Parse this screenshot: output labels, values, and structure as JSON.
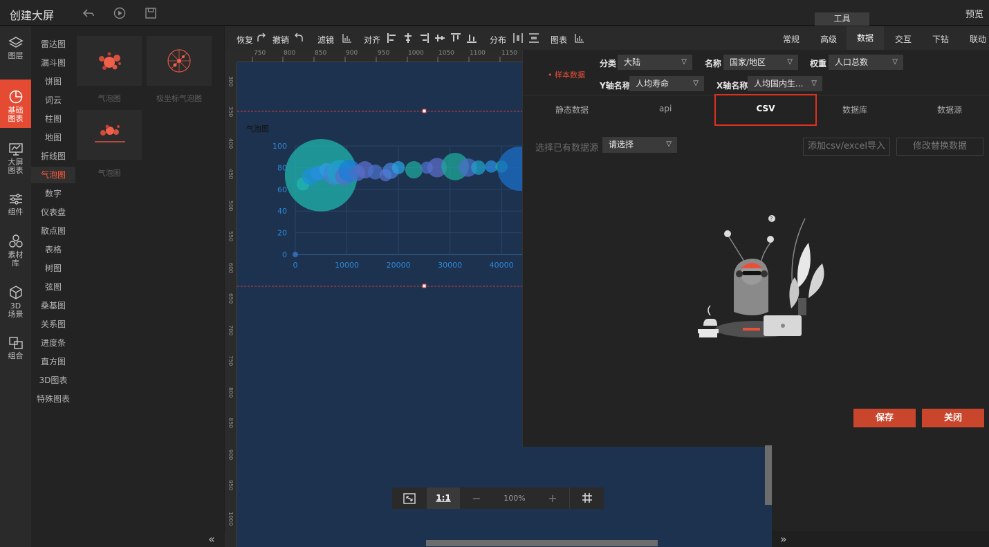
{
  "app": {
    "title": "创建大屏",
    "preview": "预览",
    "tools_tab": "工具"
  },
  "rail": [
    {
      "label": "图层",
      "icon": "layers-icon"
    },
    {
      "label": "基础图表",
      "icon": "pie-chart-icon",
      "active": true
    },
    {
      "label": "大屏图表",
      "icon": "dashboard-chart-icon"
    },
    {
      "label": "组件",
      "icon": "sliders-icon"
    },
    {
      "label": "素材库",
      "icon": "material-icon"
    },
    {
      "label": "3D场景",
      "icon": "cube-icon"
    },
    {
      "label": "组合",
      "icon": "combine-icon"
    }
  ],
  "categories": [
    "雷达图",
    "漏斗图",
    "饼图",
    "词云",
    "柱图",
    "地图",
    "折线图",
    "气泡图",
    "数字",
    "仪表盘",
    "散点图",
    "表格",
    "树图",
    "弦图",
    "桑基图",
    "关系图",
    "进度条",
    "直方图",
    "3D图表",
    "特殊图表"
  ],
  "active_category": "气泡图",
  "thumbs": [
    {
      "label": "气泡图"
    },
    {
      "label": "极坐标气泡图"
    },
    {
      "label": "气泡图"
    }
  ],
  "toolbar": {
    "redo": "恢复",
    "undo": "撤销",
    "filter": "滤镜",
    "align": "对齐",
    "distribute": "分布",
    "chart": "图表"
  },
  "ruler_h": [
    "750",
    "800",
    "850",
    "900",
    "950",
    "1000",
    "1050",
    "1100",
    "1150"
  ],
  "ruler_v": [
    "300",
    "350",
    "400",
    "450",
    "500",
    "550",
    "600",
    "650",
    "700",
    "750",
    "800",
    "850",
    "900",
    "950",
    "1000"
  ],
  "chart": {
    "title": "气泡图",
    "yticks": [
      "0",
      "20",
      "40",
      "60",
      "80",
      "100"
    ],
    "xticks": [
      "0",
      "10000",
      "20000",
      "30000",
      "40000"
    ]
  },
  "chart_data": {
    "type": "scatter",
    "title": "气泡图",
    "xlim": [
      0,
      44000
    ],
    "ylim": [
      0,
      100
    ],
    "x_ticks": [
      0,
      10000,
      20000,
      30000,
      40000
    ],
    "y_ticks": [
      0,
      20,
      40,
      60,
      80,
      100
    ],
    "points": [
      {
        "x": 5000,
        "y": 73,
        "r": 1400,
        "color": "#1fb5b0"
      },
      {
        "x": 1500,
        "y": 65,
        "r": 45,
        "color": "#1fb5b0"
      },
      {
        "x": 3000,
        "y": 72,
        "r": 80,
        "color": "#1d8fd8"
      },
      {
        "x": 4500,
        "y": 75,
        "r": 60,
        "color": "#2a8de0"
      },
      {
        "x": 6000,
        "y": 78,
        "r": 50,
        "color": "#2ba0e0"
      },
      {
        "x": 7500,
        "y": 74,
        "r": 120,
        "color": "#4a7fd8"
      },
      {
        "x": 8500,
        "y": 76,
        "r": 160,
        "color": "#1fa0c8"
      },
      {
        "x": 9500,
        "y": 72,
        "r": 90,
        "color": "#5470c6"
      },
      {
        "x": 10500,
        "y": 77,
        "r": 130,
        "color": "#1b7fd8"
      },
      {
        "x": 12000,
        "y": 75,
        "r": 70,
        "color": "#4a6fc8"
      },
      {
        "x": 13500,
        "y": 78,
        "r": 80,
        "color": "#5a6dc8"
      },
      {
        "x": 15500,
        "y": 76,
        "r": 60,
        "color": "#4a6fc8"
      },
      {
        "x": 17500,
        "y": 73,
        "r": 40,
        "color": "#5470c6"
      },
      {
        "x": 18500,
        "y": 77,
        "r": 70,
        "color": "#4a7fd8"
      },
      {
        "x": 20000,
        "y": 80,
        "r": 45,
        "color": "#2ba0e0"
      },
      {
        "x": 23000,
        "y": 78,
        "r": 80,
        "color": "#1fa89b"
      },
      {
        "x": 25500,
        "y": 80,
        "r": 40,
        "color": "#4a6fc8"
      },
      {
        "x": 27500,
        "y": 80,
        "r": 100,
        "color": "#5a6dc8"
      },
      {
        "x": 31000,
        "y": 81,
        "r": 200,
        "color": "#1fa89b"
      },
      {
        "x": 33500,
        "y": 80,
        "r": 90,
        "color": "#4a6fc8"
      },
      {
        "x": 35500,
        "y": 80,
        "r": 55,
        "color": "#1fa0c8"
      },
      {
        "x": 38000,
        "y": 81,
        "r": 40,
        "color": "#2a8de0"
      },
      {
        "x": 40000,
        "y": 81,
        "r": 40,
        "color": "#1fa89b"
      },
      {
        "x": 43500,
        "y": 79,
        "r": 520,
        "color": "#1b6fc8"
      },
      {
        "x": 0,
        "y": 0,
        "r": 8,
        "color": "#3a7ad8"
      }
    ]
  },
  "right_tabs": [
    "常规",
    "高级",
    "数据",
    "交互",
    "下钻",
    "联动"
  ],
  "active_right_tab": "数据",
  "data_panel": {
    "sample_data": "样本数据",
    "category_label": "分类",
    "category_value": "大陆",
    "name_label": "名称",
    "name_value": "国家/地区",
    "weight_label": "权重",
    "weight_value": "人口总数",
    "y_label": "Y轴名称",
    "y_value": "人均寿命",
    "x_label": "X轴名称",
    "x_value": "人均国内生...",
    "sub_tabs": [
      "静态数据",
      "api",
      "CSV",
      "数据库",
      "数据源"
    ],
    "active_sub_tab": "CSV",
    "select_source_label": "选择已有数据源",
    "select_placeholder": "请选择",
    "add_csv": "添加csv/excel导入",
    "modify_data": "修改替换数据",
    "save": "保存",
    "close": "关闭"
  },
  "zoom": {
    "ratio": "1:1",
    "minus": "−",
    "level": "100%",
    "plus": "+"
  },
  "colors": {
    "accent": "#e54a32",
    "stage_bg": "#1d324e",
    "csv_highlight": "#e0301e"
  }
}
